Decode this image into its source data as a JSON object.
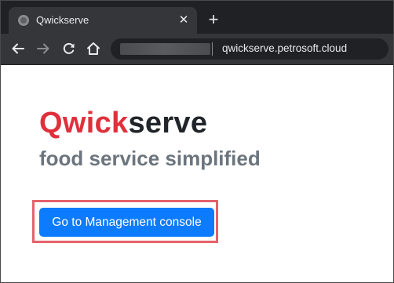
{
  "browser": {
    "tab": {
      "title": "Qwickserve",
      "close_glyph": "✕"
    },
    "new_tab_glyph": "+",
    "address_bar": {
      "url": "qwickserve.petrosoft.cloud"
    },
    "icons": {
      "favicon": "globe-icon",
      "back": "arrow-left-icon",
      "forward": "arrow-right-icon",
      "reload": "reload-icon",
      "home": "home-icon"
    },
    "colors": {
      "frame": "#202124",
      "toolbar": "#35363a",
      "text": "#e8eaed"
    }
  },
  "page": {
    "brand": {
      "part1": "Qwick",
      "part2": "serve"
    },
    "tagline": "food service simplified",
    "cta_label": "Go to Management console",
    "colors": {
      "brand_accent": "#e0303c",
      "brand_dark": "#212529",
      "tagline": "#6c757d",
      "button": "#0d7bfd",
      "highlight": "#e4626c"
    }
  }
}
